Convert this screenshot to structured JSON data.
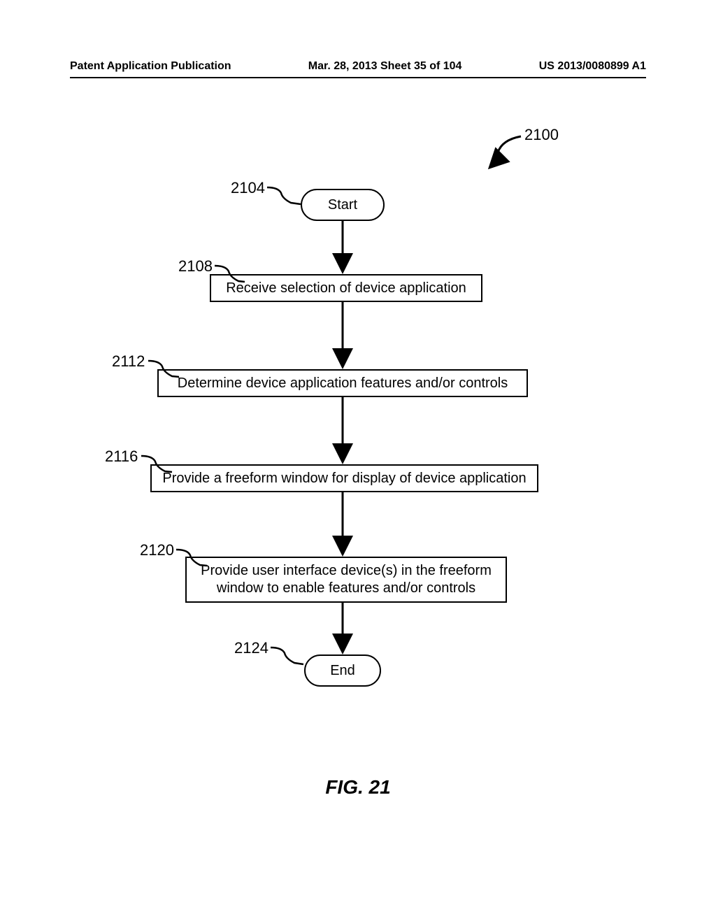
{
  "header": {
    "left": "Patent Application Publication",
    "center": "Mar. 28, 2013  Sheet 35 of 104",
    "right": "US 2013/0080899 A1"
  },
  "diagram": {
    "overall_ref": "2100",
    "caption": "FIG. 21",
    "nodes": {
      "start": {
        "ref": "2104",
        "text": "Start"
      },
      "step1": {
        "ref": "2108",
        "text": "Receive selection of device application"
      },
      "step2": {
        "ref": "2112",
        "text": "Determine device application features and/or controls"
      },
      "step3": {
        "ref": "2116",
        "text": "Provide a freeform window for display of device application"
      },
      "step4": {
        "ref": "2120",
        "text": "Provide user interface device(s) in the freeform window to enable features and/or controls"
      },
      "end": {
        "ref": "2124",
        "text": "End"
      }
    }
  }
}
